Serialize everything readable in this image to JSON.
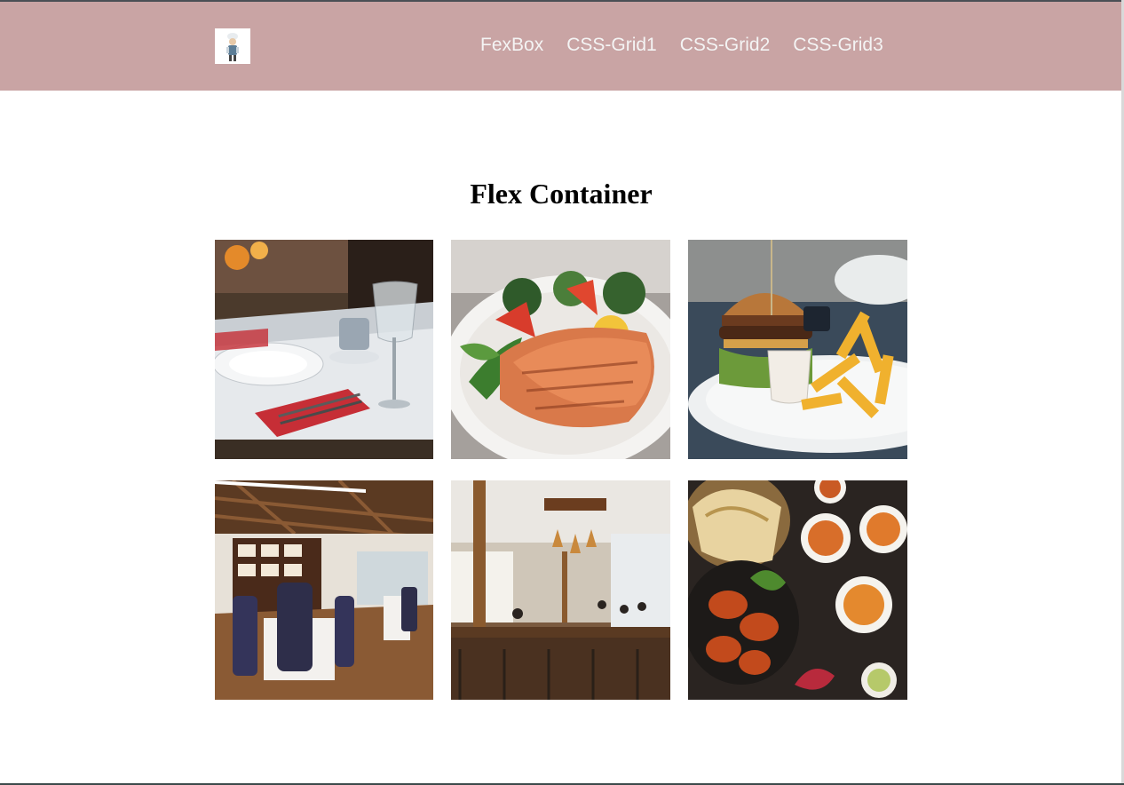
{
  "nav": {
    "logo_icon": "chef-logo-icon",
    "links": [
      {
        "label": "FexBox"
      },
      {
        "label": "CSS-Grid1"
      },
      {
        "label": "CSS-Grid2"
      },
      {
        "label": "CSS-Grid3"
      }
    ]
  },
  "main": {
    "title": "Flex Container",
    "images": [
      {
        "name": "restaurant-table-setting-image"
      },
      {
        "name": "grilled-salmon-salad-image"
      },
      {
        "name": "burger-and-fries-image"
      },
      {
        "name": "elegant-dining-room-image"
      },
      {
        "name": "rustic-cafe-interior-image"
      },
      {
        "name": "indian-food-spread-image"
      }
    ]
  },
  "colors": {
    "navbar": "#c9a4a4",
    "nav_text": "#f4f4f4",
    "title_text": "#000000"
  }
}
